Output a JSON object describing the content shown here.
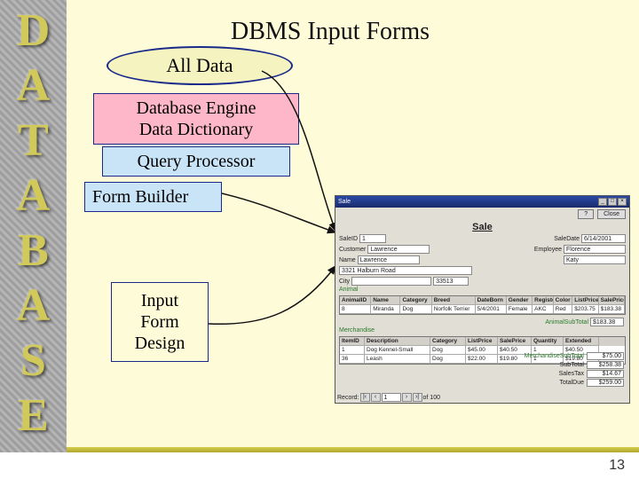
{
  "sidebar": {
    "letters": [
      "D",
      "A",
      "T",
      "A",
      "B",
      "A",
      "S",
      "E"
    ]
  },
  "title": "DBMS Input Forms",
  "ovals": {
    "all_data": "All Data"
  },
  "boxes": {
    "engine_l1": "Database Engine",
    "engine_l2": "Data Dictionary",
    "query": "Query Processor",
    "form_builder": "Form Builder",
    "input_form_l1": "Input",
    "input_form_l2": "Form",
    "input_form_l3": "Design"
  },
  "form": {
    "window_title": "Sale",
    "close": "Close",
    "question": "?",
    "heading": "Sale",
    "fields": {
      "saleid_lbl": "SaleID",
      "saleid_val": "1",
      "saledate_lbl": "SaleDate",
      "saledate_val": "6/14/2001",
      "customer_lbl": "Customer",
      "customer_val": "Lawrence",
      "employee_lbl": "Employee",
      "employee_val": "Florence",
      "name_lbl": "Name",
      "name_val": "Lawrence",
      "name2_val": "Katy",
      "address_val": "3321 Halburn Road",
      "city_val": "",
      "zip_val": "33513"
    },
    "animal_section": "Animal",
    "animal_headers": [
      "AnimalID",
      "Name",
      "Category",
      "Breed",
      "DateBorn",
      "Gender",
      "Registered",
      "Color",
      "ListPrice",
      "SalePrice"
    ],
    "animal_row": [
      "8",
      "Miranda",
      "Dog",
      "Norfolk Terrier",
      "5/4/2001",
      "Female",
      "AKC",
      "Red",
      "$203.75",
      "$183.38"
    ],
    "animal_subtotal_lbl": "AnimalSubTotal",
    "animal_subtotal_val": "$183.38",
    "merch_section": "Merchandise",
    "merch_headers": [
      "ItemID",
      "Description",
      "Category",
      "ListPrice",
      "SalePrice",
      "Quantity",
      "Extended"
    ],
    "merch_rows": [
      [
        "1",
        "Dog Kennel-Small",
        "Dog",
        "$45.00",
        "$40.50",
        "1",
        "$40.50"
      ],
      [
        "36",
        "Leash",
        "Dog",
        "$22.00",
        "$19.80",
        "1",
        "$19.80"
      ]
    ],
    "merch_subtotal_lbl": "MerchandiseSubTotal",
    "totals": {
      "merch_subtotal": "$75.00",
      "subtotal_lbl": "SubTotal",
      "subtotal": "$258.38",
      "tax_lbl": "SalesTax",
      "tax": "$14.67",
      "total_lbl": "TotalDue",
      "total": "$259.00"
    },
    "recnav_lbl": "Record:",
    "recnav_pos": "1",
    "recnav_of": "of 100"
  },
  "page_number": "13"
}
